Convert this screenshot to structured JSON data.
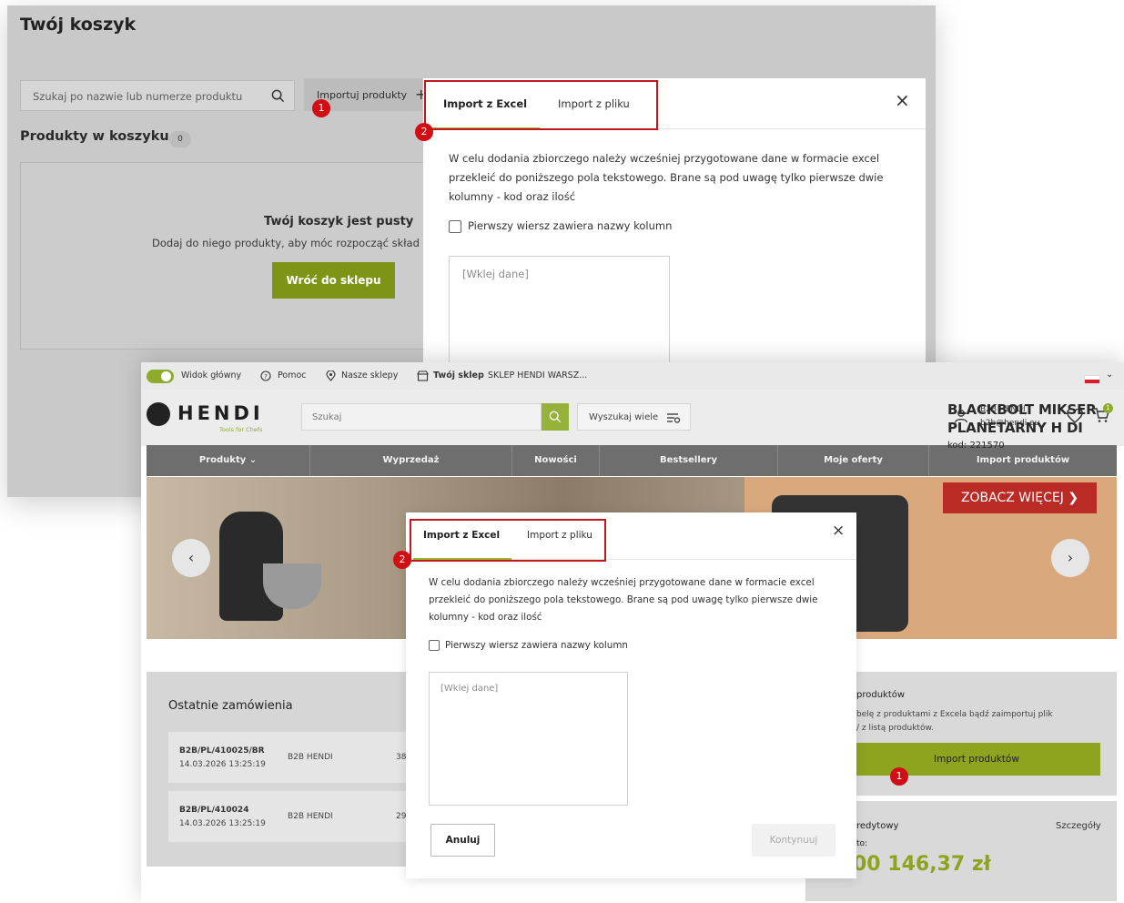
{
  "cart_page": {
    "title": "Twój koszyk",
    "search_placeholder": "Szukaj po nazwie lub numerze produktu",
    "import_button": "Importuj produkty",
    "import_button_plus": "+",
    "products_label": "Produkty w koszyku",
    "products_count": "0",
    "empty_title": "Twój koszyk jest pusty",
    "empty_subtitle": "Dodaj do niego produkty, aby móc rozpocząć skład",
    "back_button": "Wróć do sklepu",
    "modal": {
      "tab_excel": "Import z Excel",
      "tab_file": "Import z pliku",
      "close": "×",
      "description": "W celu dodania zbiorczego należy wcześniej przygotowane dane w formacie excel przekleić do poniższego pola tekstowego. Brane są pod uwagę tylko pierwsze dwie kolumny - kod oraz ilość",
      "checkbox_label": "Pierwszy wiersz zawiera nazwy kolumn",
      "textarea_placeholder": "[Wklej dane]"
    },
    "annotations": {
      "step1": "1",
      "step2": "2"
    }
  },
  "hendi_page": {
    "topbar": {
      "main_view": "Widok główny",
      "help": "Pomoc",
      "stores": "Nasze sklepy",
      "your_store_label": "Twój sklep",
      "your_store_value": "SKLEP HENDI WARSZ..."
    },
    "header": {
      "logo": "HENDI",
      "logo_tagline": "Tools for Chefs",
      "search_placeholder": "Szukaj",
      "multi_search": "Wyszukaj wiele",
      "user_name": "B2B HENDI",
      "user_email": "b2b@hendi.eu",
      "cart_badge": "1"
    },
    "nav": [
      {
        "label": "Produkty ⌄"
      },
      {
        "label": "Wyprzedaż"
      },
      {
        "label": "Nowości"
      },
      {
        "label": "Bestsellery"
      },
      {
        "label": "Moje oferty"
      },
      {
        "label": "Import produktów"
      }
    ],
    "hero": {
      "title_line1": "BLACKBOLT MIKSER",
      "title_line2": "PLANETARNY H   DI",
      "code": "kod: 221570",
      "cta": "ZOBACZ WIĘCEJ ❯",
      "prev": "‹",
      "next": "›"
    },
    "orders": {
      "title": "Ostatnie zamówienia",
      "rows": [
        {
          "id": "B2B/PL/410025/BR",
          "date": "14.03.2026 13:25:19",
          "client": "B2B HENDI",
          "trunc": "38"
        },
        {
          "id": "B2B/PL/410024",
          "date": "14.03.2026 13:25:19",
          "client": "B2B HENDI",
          "trunc": "29"
        }
      ]
    },
    "import_panel": {
      "title": "produktów",
      "desc_line1": "belę z produktami z Excela bądź zaimportuj plik",
      "desc_line2": "/ z listą produktów.",
      "button": "Import produktów"
    },
    "credit_panel": {
      "title": "redytowy",
      "details": "Szczegóły",
      "sub": "to:",
      "amount": "00 146,37 zł"
    },
    "modal": {
      "tab_excel": "Import z Excel",
      "tab_file": "Import z pliku",
      "close": "×",
      "description": "W celu dodania zbiorczego należy wcześniej przygotowane dane w formacie excel przekleić do poniższego pola tekstowego. Brane są pod uwagę tylko pierwsze dwie kolumny - kod oraz ilość",
      "checkbox_label": "Pierwszy wiersz zawiera nazwy kolumn",
      "textarea_placeholder": "[Wklej dane]",
      "cancel": "Anuluj",
      "continue": "Kontynuuj"
    },
    "annotations": {
      "step1": "1",
      "step2": "2"
    }
  },
  "colors": {
    "brand_green": "#8ea41f",
    "annotation_red": "#d00e14",
    "cta_red": "#bb2b26"
  }
}
